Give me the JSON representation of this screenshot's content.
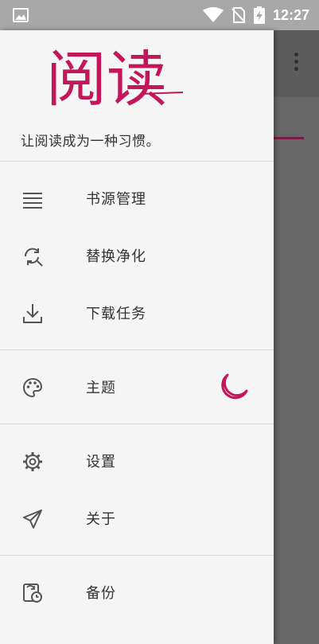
{
  "status_bar": {
    "time": "12:27",
    "icons": [
      "image-icon",
      "wifi-icon",
      "no-sim-icon",
      "battery-charging-icon"
    ]
  },
  "drawer": {
    "logo_text": "阅读",
    "slogan": "让阅读成为一种习惯。",
    "groups": [
      [
        {
          "label": "书源管理",
          "icon": "list-icon"
        },
        {
          "label": "替换净化",
          "icon": "refresh-search-icon"
        },
        {
          "label": "下载任务",
          "icon": "download-icon"
        }
      ],
      [
        {
          "label": "主题",
          "icon": "palette-icon",
          "trailing_icon": "night-mode-icon"
        }
      ],
      [
        {
          "label": "设置",
          "icon": "gear-icon"
        },
        {
          "label": "关于",
          "icon": "send-icon"
        }
      ],
      [
        {
          "label": "备份",
          "icon": "backup-icon"
        }
      ]
    ]
  },
  "colors": {
    "accent": "#c2185b",
    "drawer_bg": "#f5f5f5",
    "status_bar": "#a8a8a8",
    "scrim": "#666666"
  }
}
